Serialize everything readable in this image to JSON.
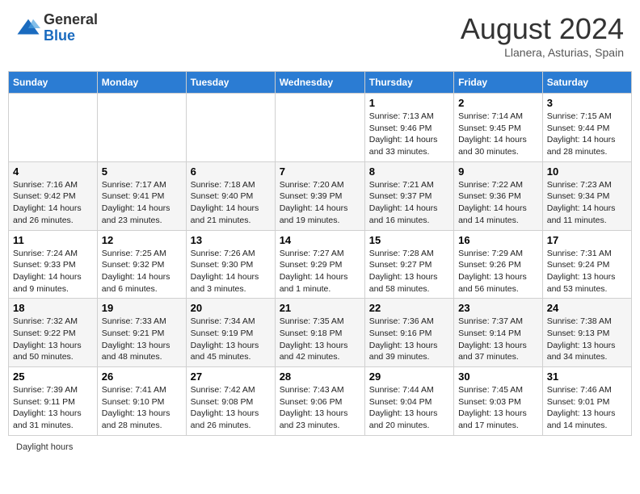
{
  "header": {
    "logo_general": "General",
    "logo_blue": "Blue",
    "month_title": "August 2024",
    "location": "Llanera, Asturias, Spain"
  },
  "footer": {
    "daylight_hours_label": "Daylight hours"
  },
  "days_of_week": [
    "Sunday",
    "Monday",
    "Tuesday",
    "Wednesday",
    "Thursday",
    "Friday",
    "Saturday"
  ],
  "weeks": [
    {
      "days": [
        {
          "num": "",
          "info": ""
        },
        {
          "num": "",
          "info": ""
        },
        {
          "num": "",
          "info": ""
        },
        {
          "num": "",
          "info": ""
        },
        {
          "num": "1",
          "info": "Sunrise: 7:13 AM\nSunset: 9:46 PM\nDaylight: 14 hours and 33 minutes."
        },
        {
          "num": "2",
          "info": "Sunrise: 7:14 AM\nSunset: 9:45 PM\nDaylight: 14 hours and 30 minutes."
        },
        {
          "num": "3",
          "info": "Sunrise: 7:15 AM\nSunset: 9:44 PM\nDaylight: 14 hours and 28 minutes."
        }
      ]
    },
    {
      "days": [
        {
          "num": "4",
          "info": "Sunrise: 7:16 AM\nSunset: 9:42 PM\nDaylight: 14 hours and 26 minutes."
        },
        {
          "num": "5",
          "info": "Sunrise: 7:17 AM\nSunset: 9:41 PM\nDaylight: 14 hours and 23 minutes."
        },
        {
          "num": "6",
          "info": "Sunrise: 7:18 AM\nSunset: 9:40 PM\nDaylight: 14 hours and 21 minutes."
        },
        {
          "num": "7",
          "info": "Sunrise: 7:20 AM\nSunset: 9:39 PM\nDaylight: 14 hours and 19 minutes."
        },
        {
          "num": "8",
          "info": "Sunrise: 7:21 AM\nSunset: 9:37 PM\nDaylight: 14 hours and 16 minutes."
        },
        {
          "num": "9",
          "info": "Sunrise: 7:22 AM\nSunset: 9:36 PM\nDaylight: 14 hours and 14 minutes."
        },
        {
          "num": "10",
          "info": "Sunrise: 7:23 AM\nSunset: 9:34 PM\nDaylight: 14 hours and 11 minutes."
        }
      ]
    },
    {
      "days": [
        {
          "num": "11",
          "info": "Sunrise: 7:24 AM\nSunset: 9:33 PM\nDaylight: 14 hours and 9 minutes."
        },
        {
          "num": "12",
          "info": "Sunrise: 7:25 AM\nSunset: 9:32 PM\nDaylight: 14 hours and 6 minutes."
        },
        {
          "num": "13",
          "info": "Sunrise: 7:26 AM\nSunset: 9:30 PM\nDaylight: 14 hours and 3 minutes."
        },
        {
          "num": "14",
          "info": "Sunrise: 7:27 AM\nSunset: 9:29 PM\nDaylight: 14 hours and 1 minute."
        },
        {
          "num": "15",
          "info": "Sunrise: 7:28 AM\nSunset: 9:27 PM\nDaylight: 13 hours and 58 minutes."
        },
        {
          "num": "16",
          "info": "Sunrise: 7:29 AM\nSunset: 9:26 PM\nDaylight: 13 hours and 56 minutes."
        },
        {
          "num": "17",
          "info": "Sunrise: 7:31 AM\nSunset: 9:24 PM\nDaylight: 13 hours and 53 minutes."
        }
      ]
    },
    {
      "days": [
        {
          "num": "18",
          "info": "Sunrise: 7:32 AM\nSunset: 9:22 PM\nDaylight: 13 hours and 50 minutes."
        },
        {
          "num": "19",
          "info": "Sunrise: 7:33 AM\nSunset: 9:21 PM\nDaylight: 13 hours and 48 minutes."
        },
        {
          "num": "20",
          "info": "Sunrise: 7:34 AM\nSunset: 9:19 PM\nDaylight: 13 hours and 45 minutes."
        },
        {
          "num": "21",
          "info": "Sunrise: 7:35 AM\nSunset: 9:18 PM\nDaylight: 13 hours and 42 minutes."
        },
        {
          "num": "22",
          "info": "Sunrise: 7:36 AM\nSunset: 9:16 PM\nDaylight: 13 hours and 39 minutes."
        },
        {
          "num": "23",
          "info": "Sunrise: 7:37 AM\nSunset: 9:14 PM\nDaylight: 13 hours and 37 minutes."
        },
        {
          "num": "24",
          "info": "Sunrise: 7:38 AM\nSunset: 9:13 PM\nDaylight: 13 hours and 34 minutes."
        }
      ]
    },
    {
      "days": [
        {
          "num": "25",
          "info": "Sunrise: 7:39 AM\nSunset: 9:11 PM\nDaylight: 13 hours and 31 minutes."
        },
        {
          "num": "26",
          "info": "Sunrise: 7:41 AM\nSunset: 9:10 PM\nDaylight: 13 hours and 28 minutes."
        },
        {
          "num": "27",
          "info": "Sunrise: 7:42 AM\nSunset: 9:08 PM\nDaylight: 13 hours and 26 minutes."
        },
        {
          "num": "28",
          "info": "Sunrise: 7:43 AM\nSunset: 9:06 PM\nDaylight: 13 hours and 23 minutes."
        },
        {
          "num": "29",
          "info": "Sunrise: 7:44 AM\nSunset: 9:04 PM\nDaylight: 13 hours and 20 minutes."
        },
        {
          "num": "30",
          "info": "Sunrise: 7:45 AM\nSunset: 9:03 PM\nDaylight: 13 hours and 17 minutes."
        },
        {
          "num": "31",
          "info": "Sunrise: 7:46 AM\nSunset: 9:01 PM\nDaylight: 13 hours and 14 minutes."
        }
      ]
    }
  ]
}
